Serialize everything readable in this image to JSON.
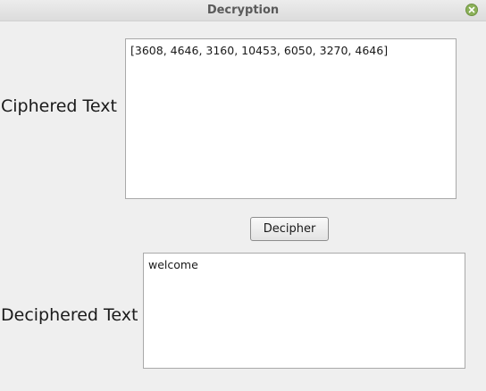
{
  "window": {
    "title": "Decryption"
  },
  "cipher": {
    "label": "Ciphered Text",
    "value": "[3608, 4646, 3160, 10453, 6050, 3270, 4646]"
  },
  "actions": {
    "decipher_label": "Decipher"
  },
  "decipher": {
    "label": "Deciphered Text",
    "value": "welcome"
  },
  "icons": {
    "close": "close-icon"
  },
  "colors": {
    "close_button": "#8bb158",
    "background": "#efefef"
  }
}
